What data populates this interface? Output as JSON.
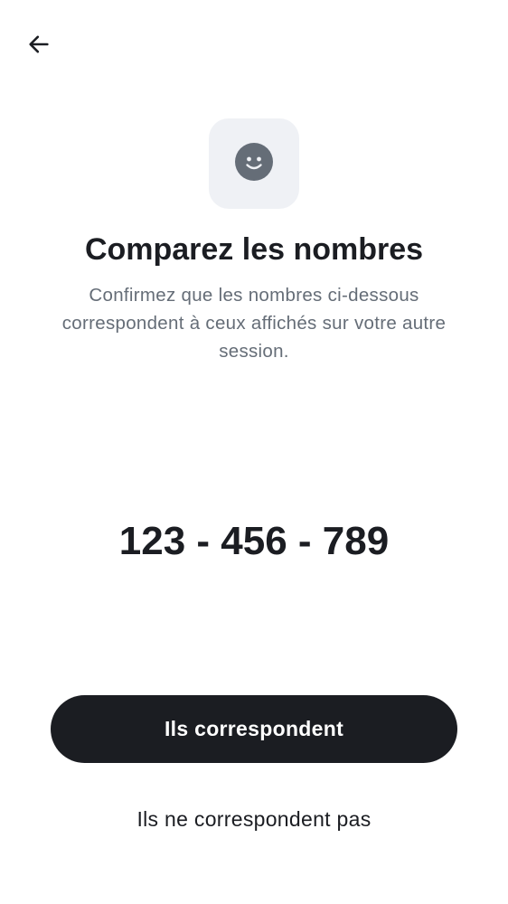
{
  "header": {
    "back_icon": "arrow-left-icon"
  },
  "hero": {
    "icon": "smiley-face-icon",
    "icon_color": "#656d77",
    "tile_color": "#eff1f5"
  },
  "title": "Comparez les nombres",
  "subtitle": "Confirmez que les nombres ci-dessous correspondent à ceux affichés sur votre autre session.",
  "verification_numbers": "123 - 456 - 789",
  "actions": {
    "confirm_label": "Ils correspondent",
    "deny_label": "Ils ne correspondent pas"
  },
  "colors": {
    "primary": "#1b1d22",
    "secondary_text": "#656d77",
    "background": "#ffffff"
  }
}
